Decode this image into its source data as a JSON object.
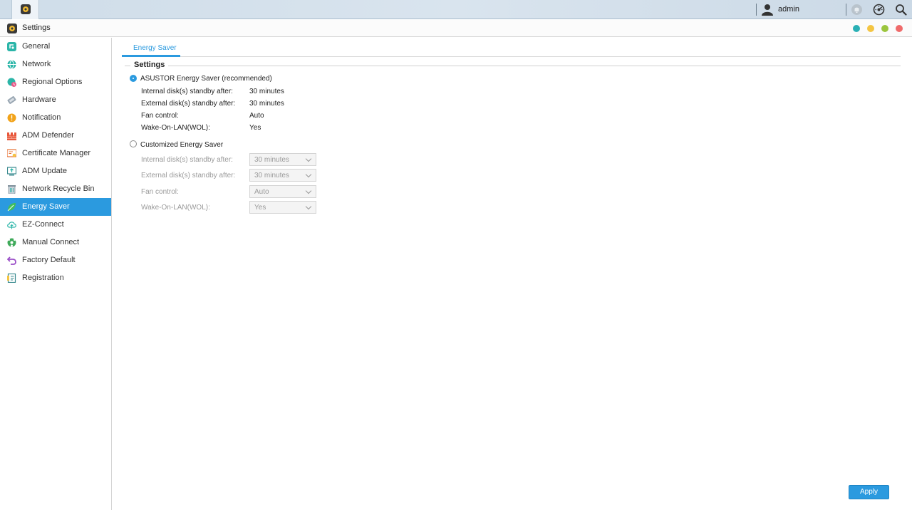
{
  "taskbar": {
    "user_name": "admin",
    "icons": [
      "settings-app-icon",
      "user-icon",
      "notification-icon",
      "activity-monitor-icon",
      "search-icon"
    ]
  },
  "window": {
    "title": "Settings",
    "controls": [
      "minimize",
      "restore",
      "maximize",
      "close"
    ],
    "control_colors": [
      "#29b0b5",
      "#f4c542",
      "#9bc53d",
      "#ef6a6a"
    ]
  },
  "sidebar": {
    "items": [
      {
        "label": "General",
        "icon": "general-icon"
      },
      {
        "label": "Network",
        "icon": "network-icon"
      },
      {
        "label": "Regional Options",
        "icon": "regional-options-icon"
      },
      {
        "label": "Hardware",
        "icon": "hardware-icon"
      },
      {
        "label": "Notification",
        "icon": "notification-icon"
      },
      {
        "label": "ADM Defender",
        "icon": "adm-defender-icon"
      },
      {
        "label": "Certificate Manager",
        "icon": "certificate-manager-icon"
      },
      {
        "label": "ADM Update",
        "icon": "adm-update-icon"
      },
      {
        "label": "Network Recycle Bin",
        "icon": "recycle-bin-icon"
      },
      {
        "label": "Energy Saver",
        "icon": "energy-saver-icon",
        "active": true
      },
      {
        "label": "EZ-Connect",
        "icon": "ez-connect-icon"
      },
      {
        "label": "Manual Connect",
        "icon": "manual-connect-icon"
      },
      {
        "label": "Factory Default",
        "icon": "factory-default-icon"
      },
      {
        "label": "Registration",
        "icon": "registration-icon"
      }
    ]
  },
  "main": {
    "tab_label": "Energy Saver",
    "section_title": "Settings",
    "asustor_option": {
      "label": "ASUSTOR Energy Saver (recommended)",
      "selected": true,
      "rows": [
        {
          "label": "Internal disk(s) standby after:",
          "value": "30 minutes"
        },
        {
          "label": "External disk(s) standby after:",
          "value": "30 minutes"
        },
        {
          "label": "Fan control:",
          "value": "Auto"
        },
        {
          "label": "Wake-On-LAN(WOL):",
          "value": "Yes"
        }
      ]
    },
    "custom_option": {
      "label": "Customized Energy Saver",
      "selected": false,
      "rows": [
        {
          "label": "Internal disk(s) standby after:",
          "value": "30 minutes"
        },
        {
          "label": "External disk(s) standby after:",
          "value": "30 minutes"
        },
        {
          "label": "Fan control:",
          "value": "Auto"
        },
        {
          "label": "Wake-On-LAN(WOL):",
          "value": "Yes"
        }
      ]
    },
    "apply_label": "Apply",
    "accent_color": "#2b9adf"
  }
}
